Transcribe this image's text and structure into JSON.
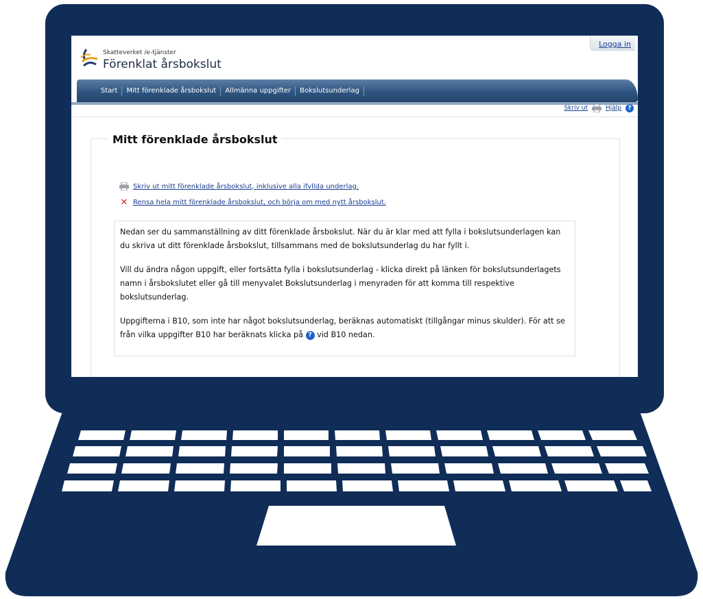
{
  "header": {
    "login_label": "Logga in",
    "org_label": "Skatteverket /e-tjänster",
    "app_title": "Förenklat årsbokslut"
  },
  "nav": {
    "items": [
      {
        "label": "Start"
      },
      {
        "label": "Mitt förenklade årsbokslut"
      },
      {
        "label": "Allmänna uppgifter"
      },
      {
        "label": "Bokslutsunderlag"
      }
    ]
  },
  "tools": {
    "print_label": "Skriv ut",
    "help_label": "Hjälp"
  },
  "main": {
    "title": "Mitt förenklade årsbokslut",
    "print_link": "Skriv ut mitt förenklade årsbokslut, inklusive alla ifyllda underlag.",
    "clear_link": "Rensa hela mitt förenklade årsbokslut, och börja om med nytt årsbokslut.",
    "para1": "Nedan ser du sammanställning av ditt förenklade årsbokslut. När du är klar med att fylla i bokslutsunderlagen kan du skriva ut ditt förenklade årsbokslut, tillsammans med de bokslutsunderlag du har fyllt i.",
    "para2": "Vill du ändra någon uppgift, eller fortsätta fylla i bokslutsunderlag - klicka direkt på länken för bokslutsunderlagets namn i årsbokslutet eller gå till menyvalet Bokslutsunderlag i menyraden för att komma till respektive bokslutsunderlag.",
    "para3_before": "Uppgifterna i B10, som inte har något bokslutsunderlag, beräknas automatiskt (tillgångar minus skulder). För att se från vilka uppgifter B10 har beräknats klicka på",
    "para3_after": "vid B10 nedan.",
    "help_glyph": "?"
  },
  "colors": {
    "laptop": "#0f2d57",
    "nav": "#2e5480",
    "link": "#1a3d8f"
  }
}
